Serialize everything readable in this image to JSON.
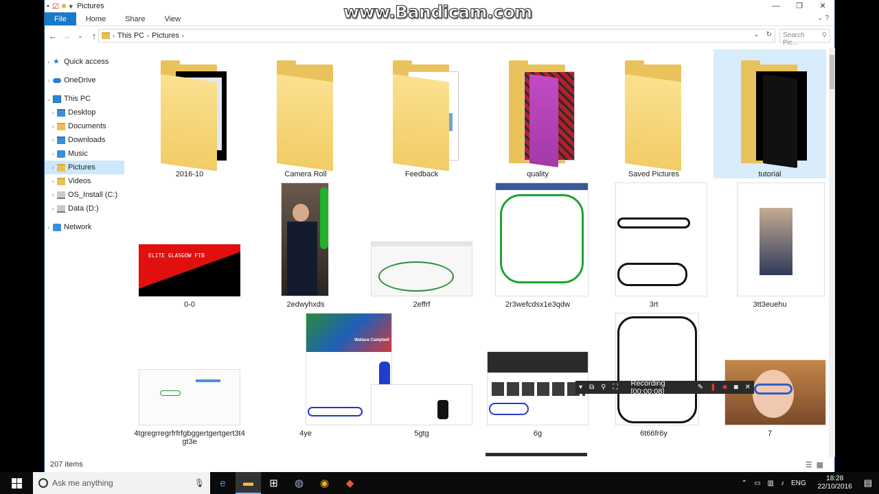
{
  "watermark": "www.Bandicam.com",
  "window": {
    "title": "Pictures"
  },
  "ribbon": {
    "tabs": [
      "File",
      "Home",
      "Share",
      "View"
    ]
  },
  "address": {
    "crumbs": [
      "This PC",
      "Pictures"
    ]
  },
  "search": {
    "placeholder": "Search Pic..."
  },
  "sidebar": {
    "items": [
      {
        "label": "Quick access",
        "icon": "star-icon"
      },
      {
        "label": "OneDrive",
        "icon": "cloud-icon"
      },
      {
        "label": "This PC",
        "icon": "computer-icon"
      },
      {
        "label": "Desktop",
        "icon": "folder-icon"
      },
      {
        "label": "Documents",
        "icon": "folder-icon"
      },
      {
        "label": "Downloads",
        "icon": "download-folder-icon"
      },
      {
        "label": "Music",
        "icon": "music-icon"
      },
      {
        "label": "Pictures",
        "icon": "pictures-folder-icon"
      },
      {
        "label": "Videos",
        "icon": "folder-icon"
      },
      {
        "label": "OS_Install (C:)",
        "icon": "drive-icon"
      },
      {
        "label": "Data (D:)",
        "icon": "drive-icon"
      },
      {
        "label": "Network",
        "icon": "network-icon"
      }
    ]
  },
  "files": {
    "folders": [
      "2016-10",
      "Camera Roll",
      "Feedback",
      "quality",
      "Saved Pictures",
      "tutorial"
    ],
    "row2": [
      "0-0",
      "2edwyhxds",
      "2effrf",
      "2r3wefcdsx1e3qdw",
      "3rt",
      "3tt3euehu"
    ],
    "row3": [
      "4tgregrregrfrfrfgbggertgertgert3t4gt3e",
      "4ye",
      "5gtg",
      "6g",
      "6t66fr6y",
      "7"
    ]
  },
  "thumbs": {
    "elite_text": "ELITE GLASGOW FTB",
    "profile_name": "Wallace Campbell"
  },
  "status": {
    "items": "207 items"
  },
  "recording": {
    "label": "Recording [00:00:08]"
  },
  "taskbar": {
    "search_placeholder": "Ask me anything",
    "lang": "ENG",
    "time": "18:28",
    "date": "22/10/2016"
  }
}
